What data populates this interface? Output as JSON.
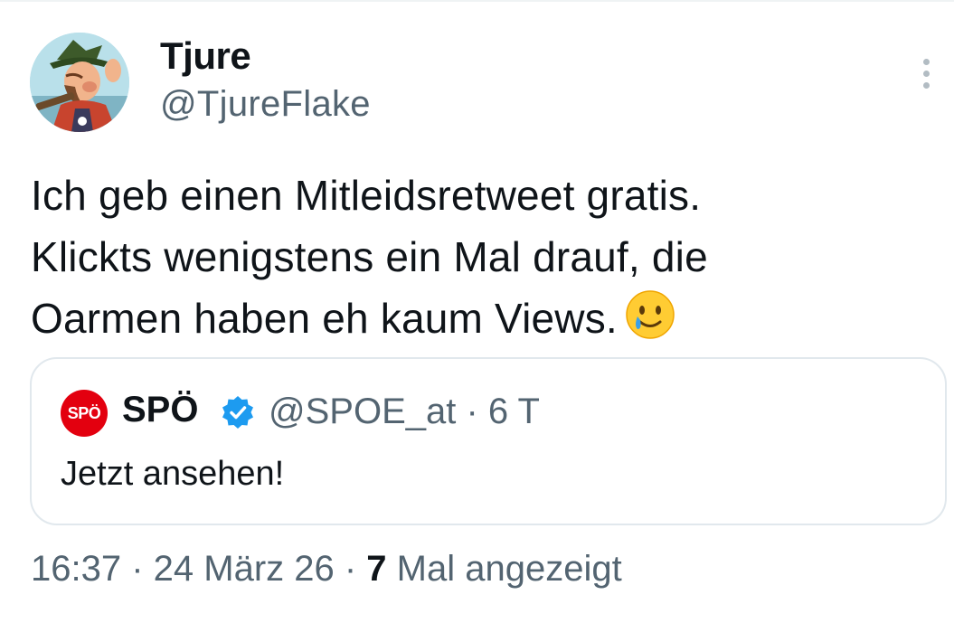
{
  "tweet": {
    "author": {
      "name": "Tjure",
      "handle": "@TjureFlake"
    },
    "text_lines": [
      "Ich geb einen Mitleidsretweet gratis.",
      "Klickts wenigstens ein Mal drauf, die",
      "Oarmen haben eh kaum Views."
    ],
    "emoji": "smiling-face-with-tear",
    "more_icon": "more-vertical-icon",
    "quoted_tweet": {
      "logo_text": "SPÖ",
      "name": "SPÖ",
      "verified": true,
      "handle_and_time": "@SPOE_at · 6 T",
      "text": "Jetzt ansehen!"
    },
    "meta": {
      "time_date": "16:37 · 24 März 26 · ",
      "views_count": "7",
      "views_label": " Mal angezeigt"
    },
    "colors": {
      "text": "#0f1419",
      "secondary": "#536471",
      "verified": "#1d9bf0",
      "spoe_red": "#e3000f",
      "border": "#e1e8ed"
    }
  }
}
